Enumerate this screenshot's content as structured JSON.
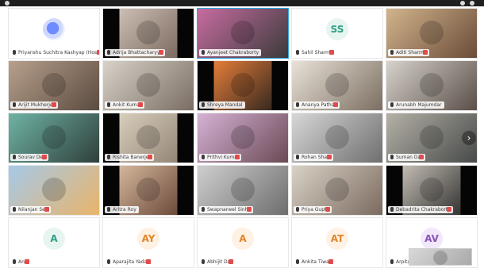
{
  "window": {
    "title_bar": ""
  },
  "gallery": {
    "participants": [
      {
        "name": "Priyanshu Suchitra Kashyap (Host)",
        "kind": "avatar",
        "initials": "",
        "avatar_color": "photo",
        "muted": true,
        "active": false
      },
      {
        "name": "Adrija Bhattacharyya",
        "kind": "video",
        "colors": [
          "#d9cbbf",
          "#6f5e55"
        ],
        "black_sides": true,
        "muted": true,
        "active": false
      },
      {
        "name": "Ayanjeet Chakraborty",
        "kind": "video",
        "colors": [
          "#c76ca0",
          "#3b3b3b"
        ],
        "black_sides": false,
        "muted": false,
        "active": true
      },
      {
        "name": "Sahil Sharma",
        "kind": "avatar",
        "initials": "SS",
        "avatar_color": "teal",
        "muted": true,
        "active": false
      },
      {
        "name": "Aditi Sharma",
        "kind": "video",
        "colors": [
          "#d2b48c",
          "#6a4c3a"
        ],
        "black_sides": false,
        "muted": true,
        "active": false
      },
      {
        "name": "Arijit Mukherjee",
        "kind": "video",
        "colors": [
          "#b7a08c",
          "#5b4b40"
        ],
        "black_sides": false,
        "muted": true,
        "active": false
      },
      {
        "name": "Ankit Kumar",
        "kind": "video",
        "colors": [
          "#d8d2c9",
          "#7a6e63"
        ],
        "black_sides": false,
        "muted": true,
        "active": false
      },
      {
        "name": "Shreya Mandal",
        "kind": "video",
        "colors": [
          "#ff8a3d",
          "#1c1c1c"
        ],
        "black_sides": true,
        "muted": false,
        "active": false
      },
      {
        "name": "Ananya Pathak",
        "kind": "video",
        "colors": [
          "#e9e2d8",
          "#7c6f62"
        ],
        "black_sides": false,
        "muted": true,
        "active": false
      },
      {
        "name": "Arunabh Majumdar",
        "kind": "video",
        "colors": [
          "#d7d2cc",
          "#5a4f48"
        ],
        "black_sides": false,
        "muted": false,
        "active": false
      },
      {
        "name": "Sourav Dey",
        "kind": "video",
        "colors": [
          "#6fb3a5",
          "#2f3f3b"
        ],
        "black_sides": false,
        "muted": true,
        "active": false
      },
      {
        "name": "Rishita Banerjee",
        "kind": "video",
        "colors": [
          "#e2d9c7",
          "#8a7b6c"
        ],
        "black_sides": true,
        "muted": true,
        "active": false
      },
      {
        "name": "Prithvi Kumar",
        "kind": "video",
        "colors": [
          "#d6b2d6",
          "#6b4a55"
        ],
        "black_sides": false,
        "muted": true,
        "active": false
      },
      {
        "name": "Rohan Shaw",
        "kind": "video",
        "colors": [
          "#d7d7d7",
          "#6f6f6f"
        ],
        "black_sides": false,
        "muted": true,
        "active": false
      },
      {
        "name": "Suman Das",
        "kind": "video",
        "colors": [
          "#b5b1a7",
          "#474a49"
        ],
        "black_sides": false,
        "muted": true,
        "active": false
      },
      {
        "name": "Nilanjan Sen",
        "kind": "video",
        "colors": [
          "#a6c9e8",
          "#e9b46a"
        ],
        "black_sides": false,
        "muted": true,
        "active": false
      },
      {
        "name": "Aritra Roy",
        "kind": "video",
        "colors": [
          "#e3c7a9",
          "#5d3a2e"
        ],
        "black_sides": true,
        "muted": false,
        "active": false
      },
      {
        "name": "Swapnaneel Sinha",
        "kind": "video",
        "colors": [
          "#cfcfcf",
          "#6d6d6d"
        ],
        "black_sides": false,
        "muted": true,
        "active": false
      },
      {
        "name": "Priya Gupta",
        "kind": "video",
        "colors": [
          "#d9d2c6",
          "#7b6a5f"
        ],
        "black_sides": false,
        "muted": true,
        "active": false
      },
      {
        "name": "Debadrita Chakraborty",
        "kind": "video",
        "colors": [
          "#d8d1c7",
          "#1e1e1e"
        ],
        "black_sides": true,
        "muted": true,
        "active": false
      },
      {
        "name": "Anik",
        "kind": "avatar",
        "initials": "A",
        "avatar_color": "teal",
        "muted": true,
        "active": false
      },
      {
        "name": "Aparajita Yadav",
        "kind": "avatar",
        "initials": "AY",
        "avatar_color": "orange",
        "muted": true,
        "active": false
      },
      {
        "name": "Abhijit Das",
        "kind": "avatar",
        "initials": "A",
        "avatar_color": "orange",
        "muted": true,
        "active": false
      },
      {
        "name": "Ankita Tiwari",
        "kind": "avatar",
        "initials": "AT",
        "avatar_color": "orange",
        "muted": true,
        "active": false
      },
      {
        "name": "Arpita Verma",
        "kind": "avatar",
        "initials": "AV",
        "avatar_color": "purple",
        "muted": true,
        "active": false,
        "pip": true
      }
    ],
    "next_page_arrow": "›"
  }
}
